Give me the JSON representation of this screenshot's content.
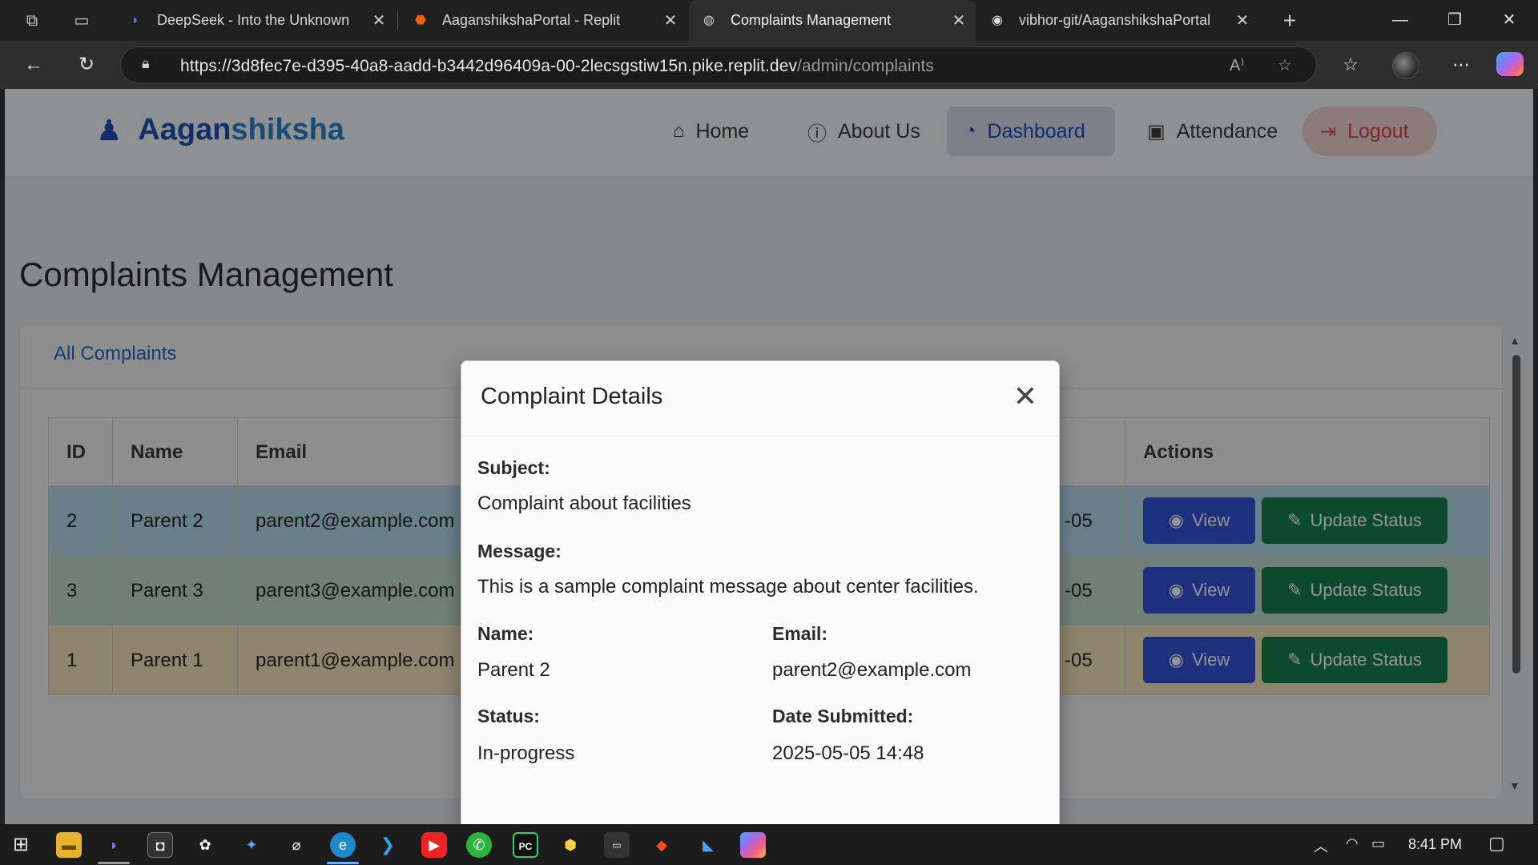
{
  "browser": {
    "tabs": [
      {
        "title": "DeepSeek - Into the Unknown",
        "favicon": "deepseek-whale-icon"
      },
      {
        "title": "AaganshikshaPortal - Replit",
        "favicon": "replit-icon"
      },
      {
        "title": "Complaints Management",
        "favicon": "globe-icon"
      },
      {
        "title": "vibhor-git/AaganshikshaPortal",
        "favicon": "github-icon"
      }
    ],
    "url_main": "https://3d8fec7e-d395-40a8-aadd-b3442d96409a-00-2lecsgstiw15n.pike.replit.dev",
    "url_path": "/admin/complaints"
  },
  "site": {
    "brand_prefix": "Aagan",
    "brand_suffix": "shiksha",
    "nav": {
      "home": "Home",
      "about": "About Us",
      "dashboard": "Dashboard",
      "attendance": "Attendance",
      "logout": "Logout"
    }
  },
  "page": {
    "title": "Complaints Management",
    "card_link": "All Complaints",
    "table": {
      "headers": {
        "id": "ID",
        "name": "Name",
        "email": "Email",
        "actions": "Actions"
      },
      "rows": [
        {
          "id": "2",
          "name": "Parent 2",
          "email": "parent2@example.com",
          "date_tail": "-05",
          "view": "View",
          "update": "Update Status",
          "color": "#b7dcec"
        },
        {
          "id": "3",
          "name": "Parent 3",
          "email": "parent3@example.com",
          "date_tail": "-05",
          "view": "View",
          "update": "Update Status",
          "color": "#c2dcd0"
        },
        {
          "id": "1",
          "name": "Parent 1",
          "email": "parent1@example.com",
          "date_tail": "-05",
          "view": "View",
          "update": "Update Status",
          "color": "#f5e6bd"
        }
      ]
    }
  },
  "modal": {
    "title": "Complaint Details",
    "subject_label": "Subject:",
    "subject": "Complaint about facilities",
    "message_label": "Message:",
    "message": "This is a sample complaint message about center facilities.",
    "name_label": "Name:",
    "name": "Parent 2",
    "email_label": "Email:",
    "email": "parent2@example.com",
    "status_label": "Status:",
    "status": "In-progress",
    "date_label": "Date Submitted:",
    "date": "2025-05-05 14:48"
  },
  "taskbar": {
    "clock": "8:41 PM"
  },
  "colors": {
    "primary": "#3552d9",
    "success": "#17804f",
    "brand": "#1d4fba",
    "danger": "#d94646"
  }
}
